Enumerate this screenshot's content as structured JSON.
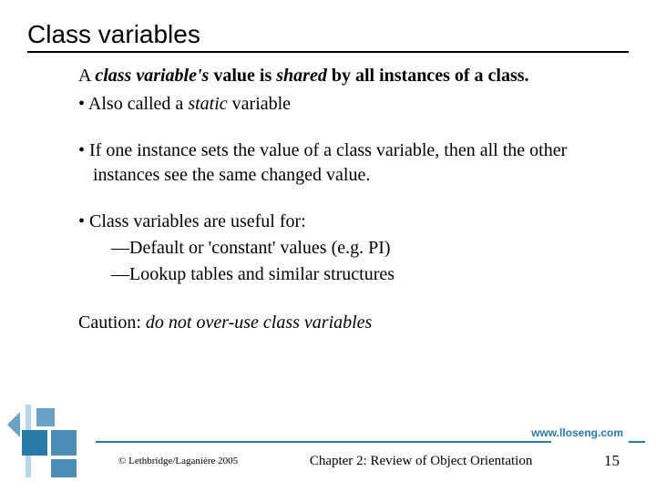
{
  "title": "Class variables",
  "intro": {
    "pre": "A ",
    "em1": "class variable's",
    "mid": " value is ",
    "em2": "shared",
    "post": " by all instances of a class."
  },
  "bullets": {
    "b1_pre": "Also called a ",
    "b1_em": "static",
    "b1_post": " variable",
    "b2": "If one instance sets the value of a class variable, then all the other instances see the same changed value.",
    "b3": "Class variables are useful for:",
    "b3_sub1": "—Default or 'constant' values (e.g. PI)",
    "b3_sub2": "—Lookup tables and similar structures"
  },
  "caution": {
    "label": "Caution: ",
    "text": "do not over-use class variables"
  },
  "footer": {
    "url": "www.lloseng.com",
    "copyright": "© Lethbridge/Laganière 2005",
    "chapter": "Chapter 2: Review of Object Orientation",
    "page": "15"
  }
}
